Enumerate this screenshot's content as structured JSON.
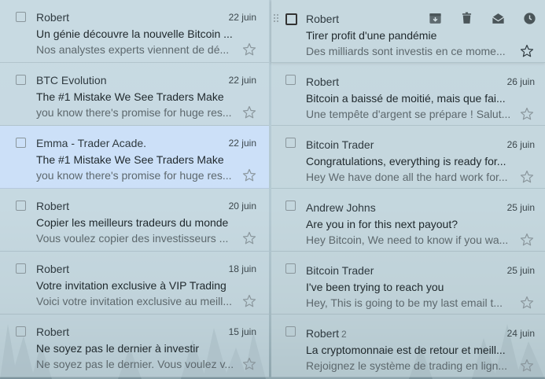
{
  "left_column": [
    {
      "sender": "Robert",
      "date": "22 juin",
      "subject": "Un génie découvre la nouvelle Bitcoin ...",
      "snippet": "Nos analystes experts viennent de dé...",
      "selected": false
    },
    {
      "sender": "BTC Evolution",
      "date": "22 juin",
      "subject": "The #1 Mistake We See Traders Make",
      "snippet": "you know there's promise for huge res...",
      "selected": false
    },
    {
      "sender": "Emma - Trader Acade.",
      "date": "22 juin",
      "subject": "The #1 Mistake We See Traders Make",
      "snippet": "you know there's promise for huge res...",
      "selected": true
    },
    {
      "sender": "Robert",
      "date": "20 juin",
      "subject": "Copier les meilleurs tradeurs du monde",
      "snippet": "Vous voulez copier des investisseurs ...",
      "selected": false
    },
    {
      "sender": "Robert",
      "date": "18 juin",
      "subject": "Votre invitation exclusive à VIP Trading",
      "snippet": "Voici votre invitation exclusive au meill...",
      "selected": false
    },
    {
      "sender": "Robert",
      "date": "15 juin",
      "subject": "Ne soyez pas le dernier à investir",
      "snippet": "Ne soyez pas le dernier. Vous voulez v...",
      "selected": false
    }
  ],
  "right_column": [
    {
      "sender": "Robert",
      "date": "",
      "subject": "Tirer profit d'une pandémie",
      "snippet": "Des milliards sont investis en ce mome...",
      "hovered": true
    },
    {
      "sender": "Robert",
      "date": "26 juin",
      "subject": "Bitcoin a baissé de moitié, mais que fai...",
      "snippet": "Une tempête d'argent se prépare ! Salut...",
      "hovered": false
    },
    {
      "sender": "Bitcoin Trader",
      "date": "26 juin",
      "subject": "Congratulations, everything is ready for...",
      "snippet": "Hey We have done all the hard work for...",
      "hovered": false
    },
    {
      "sender": "Andrew Johns",
      "date": "25 juin",
      "subject": "Are you in for this next payout?",
      "snippet": "Hey Bitcoin, We need to know if you wa...",
      "hovered": false
    },
    {
      "sender": "Bitcoin Trader",
      "date": "25 juin",
      "subject": "I've been trying to reach you",
      "snippet": "Hey, This is going to be my last email t...",
      "hovered": false
    },
    {
      "sender": "Robert",
      "sender_count": "2",
      "date": "24 juin",
      "subject": "La cryptomonnaie est de retour et meill...",
      "snippet": "Rejoignez le système de trading en lign...",
      "hovered": false
    }
  ],
  "hover_actions": [
    "archive-icon",
    "delete-icon",
    "mark-as-read-icon",
    "snooze-icon"
  ],
  "colors": {
    "selected_row": "#cde0fa",
    "background": "#b9cdd6",
    "text_primary": "#1f282c",
    "text_secondary": "#5d686d"
  }
}
